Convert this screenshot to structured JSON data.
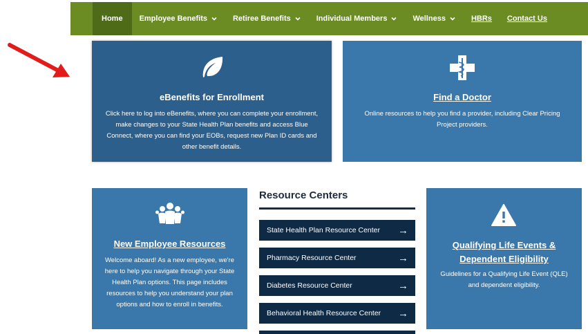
{
  "nav": {
    "home": "Home",
    "employee_benefits": "Employee Benefits",
    "retiree_benefits": "Retiree Benefits",
    "individual_members": "Individual Members",
    "wellness": "Wellness",
    "hbrs": "HBRs",
    "contact_us": "Contact Us"
  },
  "cards": {
    "ebenefits": {
      "title": "eBenefits for Enrollment",
      "body": "Click here to log into eBenefits, where you can complete your enrollment, make changes to your State Health Plan benefits and access Blue Connect, where you can find your EOBs, request new Plan ID cards and other benefit details.",
      "icon": "leaf-icon"
    },
    "find_doctor": {
      "title": "Find a Doctor",
      "body": "Online resources to help you find a provider, including Clear Pricing Project providers.",
      "icon": "medical-cross-icon"
    },
    "new_employee": {
      "title": "New Employee Resources",
      "body": "Welcome aboard! As a new employee, we're here to help you navigate through your State Health Plan options. This page includes resources to help you understand your plan options and how to enroll in benefits.",
      "icon": "people-group-icon"
    },
    "qle": {
      "title": "Qualifying Life Events & Dependent Eligibility",
      "body": "Guidelines for a Qualifying Life Event (QLE) and dependent eligibility.",
      "icon": "warning-icon"
    }
  },
  "resource_centers": {
    "title": "Resource Centers",
    "items": [
      "State Health Plan Resource Center",
      "Pharmacy Resource Center",
      "Diabetes Resource Center",
      "Behavioral Health Resource Center"
    ]
  },
  "colors": {
    "nav_bg": "#6b8c23",
    "nav_active": "#4e6b17",
    "card_blue": "#3a78ab",
    "card_dark": "#2c5f8b",
    "resource_btn": "#0f2a45",
    "pointer_red": "#e21b1b"
  }
}
